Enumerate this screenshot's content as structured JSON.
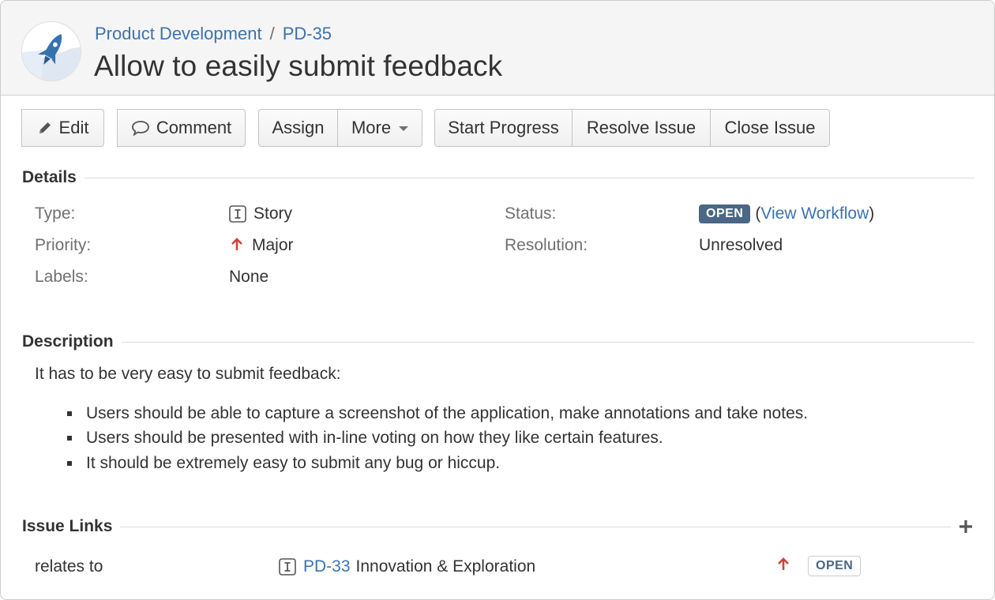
{
  "header": {
    "breadcrumb": {
      "project": "Product Development",
      "separator": "/",
      "issue_key": "PD-35"
    },
    "title": "Allow to easily submit feedback",
    "avatar_icon": "rocket-icon"
  },
  "toolbar": {
    "edit_label": "Edit",
    "comment_label": "Comment",
    "assign_label": "Assign",
    "more_label": "More",
    "start_progress_label": "Start Progress",
    "resolve_issue_label": "Resolve Issue",
    "close_issue_label": "Close Issue"
  },
  "details": {
    "heading": "Details",
    "type_label": "Type:",
    "type_value": "Story",
    "priority_label": "Priority:",
    "priority_value": "Major",
    "labels_label": "Labels:",
    "labels_value": "None",
    "status_label": "Status:",
    "status_value": "OPEN",
    "workflow_open_paren": "(",
    "workflow_link": "View Workflow",
    "workflow_close_paren": ")",
    "resolution_label": "Resolution:",
    "resolution_value": "Unresolved"
  },
  "description": {
    "heading": "Description",
    "intro": "It has to be very easy to submit feedback:",
    "bullets": [
      "Users should be able to capture a screenshot of the application, make annotations and take notes.",
      "Users should be presented with in-line voting on how they like certain features.",
      "It should be extremely easy to submit any bug or hiccup."
    ]
  },
  "issue_links": {
    "heading": "Issue Links",
    "rows": [
      {
        "relation": "relates to",
        "key": "PD-33",
        "summary": "Innovation & Exploration",
        "status": "OPEN"
      }
    ]
  },
  "colors": {
    "link": "#3b73af",
    "priority_major": "#d04437",
    "status_open": "#4a6785",
    "header_bg": "#f5f5f5"
  }
}
